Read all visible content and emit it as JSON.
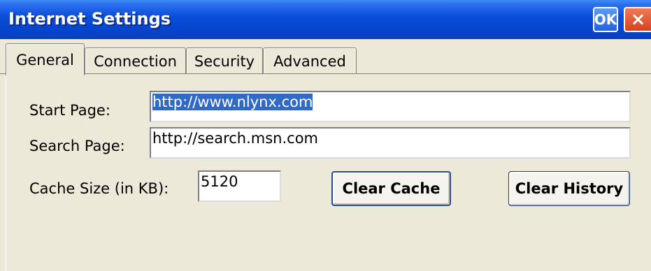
{
  "window": {
    "title": "Internet Settings"
  },
  "titlebar": {
    "ok_label": "OK",
    "close_label": "×"
  },
  "tabs": [
    {
      "label": "General",
      "active": true
    },
    {
      "label": "Connection",
      "active": false
    },
    {
      "label": "Security",
      "active": false
    },
    {
      "label": "Advanced",
      "active": false
    }
  ],
  "general": {
    "start_page": {
      "label": "Start Page:",
      "value": "http://www.nlynx.com"
    },
    "search_page": {
      "label": "Search Page:",
      "value": "http://search.msn.com"
    },
    "cache_size": {
      "label": "Cache Size (in KB):",
      "value": "5120"
    },
    "clear_cache_label": "Clear Cache",
    "clear_history_label": "Clear History"
  },
  "colors": {
    "titlebar": "#0a4fd8",
    "window_bg": "#ece9d8",
    "selection": "#316ac5",
    "close_button": "#d8421c"
  },
  "icons": {
    "close": "close-icon",
    "ok": "ok-icon"
  }
}
